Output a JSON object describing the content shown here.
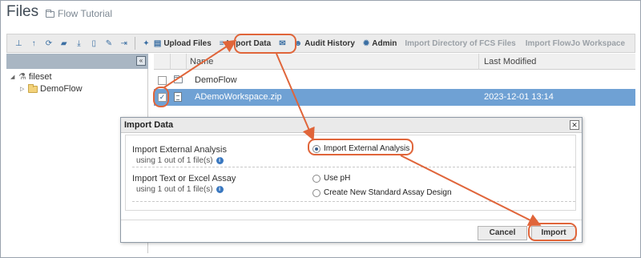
{
  "header": {
    "title": "Files",
    "breadcrumb": "Flow Tutorial"
  },
  "toolbar": {
    "icons": [
      "sitemap-icon",
      "arrow-up-icon",
      "refresh-icon",
      "new-folder-icon",
      "download-icon",
      "delete-icon",
      "edit-icon",
      "move-icon",
      "wrench-icon"
    ],
    "upload_files": "Upload Files",
    "import_data": "Import Data",
    "email_icon": "envelope-icon",
    "audit_history": "Audit History",
    "admin": "Admin",
    "import_directory": "Import Directory of FCS Files",
    "import_flowjo": "Import FlowJo Workspace"
  },
  "tree": {
    "root": "fileset",
    "child": "DemoFlow"
  },
  "grid": {
    "columns": [
      "Name",
      "Last Modified"
    ],
    "rows": [
      {
        "name": "DemoFlow",
        "modified": "",
        "type": "folder",
        "checked": false
      },
      {
        "name": "ADemoWorkspace.zip",
        "modified": "2023-12-01 13:14",
        "type": "file",
        "checked": true
      }
    ]
  },
  "dialog": {
    "title": "Import Data",
    "option1": {
      "label": "Import External Analysis",
      "sub": "using 1 out of 1 file(s)",
      "choice": "Import External Analysis"
    },
    "option2": {
      "label": "Import Text or Excel Assay",
      "sub": "using 1 out of 1 file(s)",
      "choices": [
        "Use pH",
        "Create New Standard Assay Design"
      ]
    },
    "cancel": "Cancel",
    "import": "Import"
  },
  "colors": {
    "accent": "#e0653a",
    "selection": "#6fa1d4",
    "link": "#3b6fa3"
  }
}
